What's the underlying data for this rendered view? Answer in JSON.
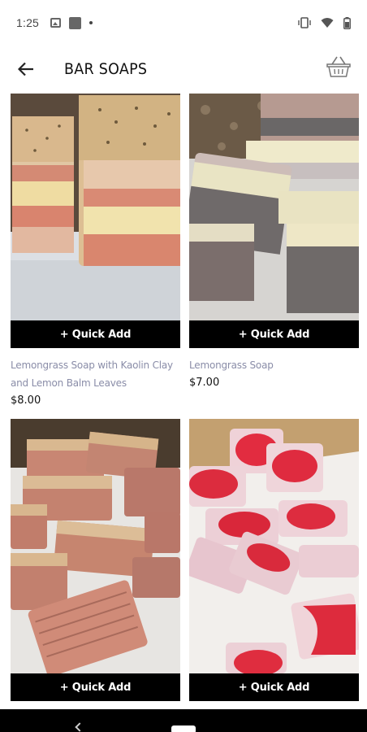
{
  "status": {
    "time": "1:25"
  },
  "header": {
    "title": "BAR SOAPS"
  },
  "products": [
    {
      "quick_add": "+ Quick Add",
      "name": "Lemongrass Soap with Kaolin Clay and Lemon Balm Leaves",
      "price": "$8.00"
    },
    {
      "quick_add": "+ Quick Add",
      "name": "Lemongrass Soap",
      "price": "$7.00"
    },
    {
      "quick_add": "+ Quick Add"
    },
    {
      "quick_add": "+ Quick Add"
    }
  ],
  "colors": {
    "accent_button": "#000000",
    "product_name": "#8a8da8"
  }
}
